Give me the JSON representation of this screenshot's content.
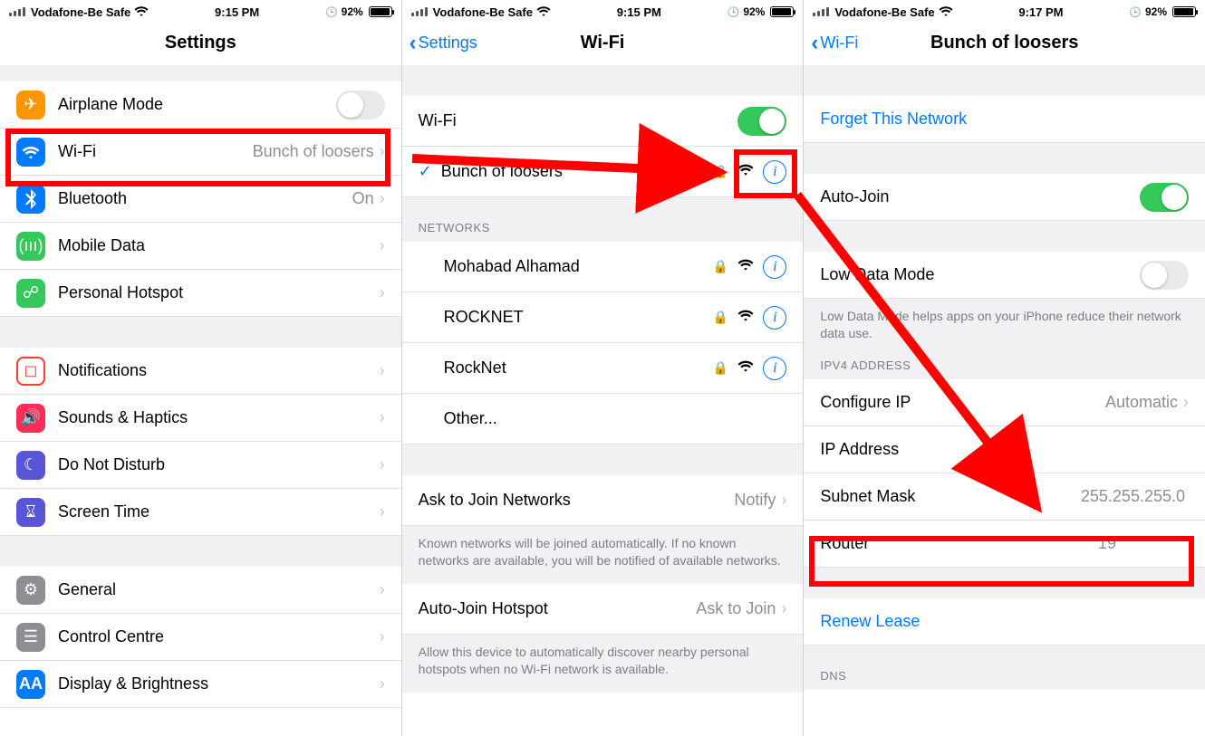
{
  "screens": {
    "s1": {
      "status": {
        "carrier": "Vodafone-Be Safe",
        "time": "9:15 PM",
        "battery": "92%"
      },
      "title": "Settings",
      "rows": {
        "airplane": "Airplane Mode",
        "wifi": {
          "label": "Wi-Fi",
          "value": "Bunch of loosers"
        },
        "bluetooth": {
          "label": "Bluetooth",
          "value": "On"
        },
        "mobile": "Mobile Data",
        "hotspot": "Personal Hotspot",
        "notifications": "Notifications",
        "sounds": "Sounds & Haptics",
        "dnd": "Do Not Disturb",
        "screentime": "Screen Time",
        "general": "General",
        "control": "Control Centre",
        "display": "Display & Brightness"
      }
    },
    "s2": {
      "status": {
        "carrier": "Vodafone-Be Safe",
        "time": "9:15 PM",
        "battery": "92%"
      },
      "back": "Settings",
      "title": "Wi-Fi",
      "wifi_toggle_label": "Wi-Fi",
      "current_network": "Bunch of loosers",
      "networks_header": "NETWORKS",
      "networks": [
        "Mohabad Alhamad",
        "ROCKNET",
        "RockNet"
      ],
      "other": "Other...",
      "ask": {
        "label": "Ask to Join Networks",
        "value": "Notify"
      },
      "ask_footer": "Known networks will be joined automatically. If no known networks are available, you will be notified of available networks.",
      "autojoin": {
        "label": "Auto-Join Hotspot",
        "value": "Ask to Join"
      },
      "autojoin_footer": "Allow this device to automatically discover nearby personal hotspots when no Wi-Fi network is available."
    },
    "s3": {
      "status": {
        "carrier": "Vodafone-Be Safe",
        "time": "9:17 PM",
        "battery": "92%"
      },
      "back": "Wi-Fi",
      "title": "Bunch of loosers",
      "forget": "Forget This Network",
      "autojoin": "Auto-Join",
      "lowdata": "Low Data Mode",
      "lowdata_footer": "Low Data Mode helps apps on your iPhone reduce their network data use.",
      "ipv4_header": "IPV4 ADDRESS",
      "configip": {
        "label": "Configure IP",
        "value": "Automatic"
      },
      "ipaddr": "IP Address",
      "subnet": {
        "label": "Subnet Mask",
        "value": "255.255.255.0"
      },
      "router": {
        "label": "Router",
        "value": "19"
      },
      "renew": "Renew Lease",
      "dns_header": "DNS"
    }
  }
}
